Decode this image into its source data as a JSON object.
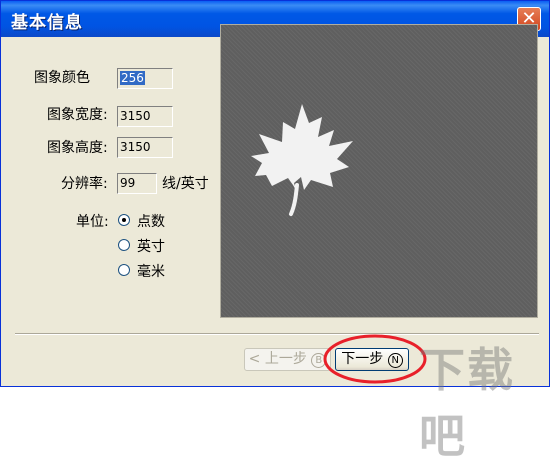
{
  "window": {
    "title": "基本信息"
  },
  "fields": {
    "color": {
      "label": "图象颜色",
      "value": "256"
    },
    "width": {
      "label": "图象宽度:",
      "value": "3150"
    },
    "height": {
      "label": "图象高度:",
      "value": "3150"
    },
    "resolution": {
      "label": "分辨率:",
      "value": "99",
      "unit": "线/英寸"
    }
  },
  "units": {
    "label": "单位:",
    "options": [
      "点数",
      "英寸",
      "毫米"
    ],
    "selected": "点数"
  },
  "buttons": {
    "back": {
      "label": "< 上一步",
      "key": "B"
    },
    "next": {
      "label": "下一步",
      "key": "N"
    }
  },
  "watermark": {
    "text": "下载吧"
  },
  "colors": {
    "titlebar": "#0054e3",
    "dialog_bg": "#ece9d8",
    "preview_bg": "#5f5f5f",
    "annotation": "#e8202a"
  }
}
